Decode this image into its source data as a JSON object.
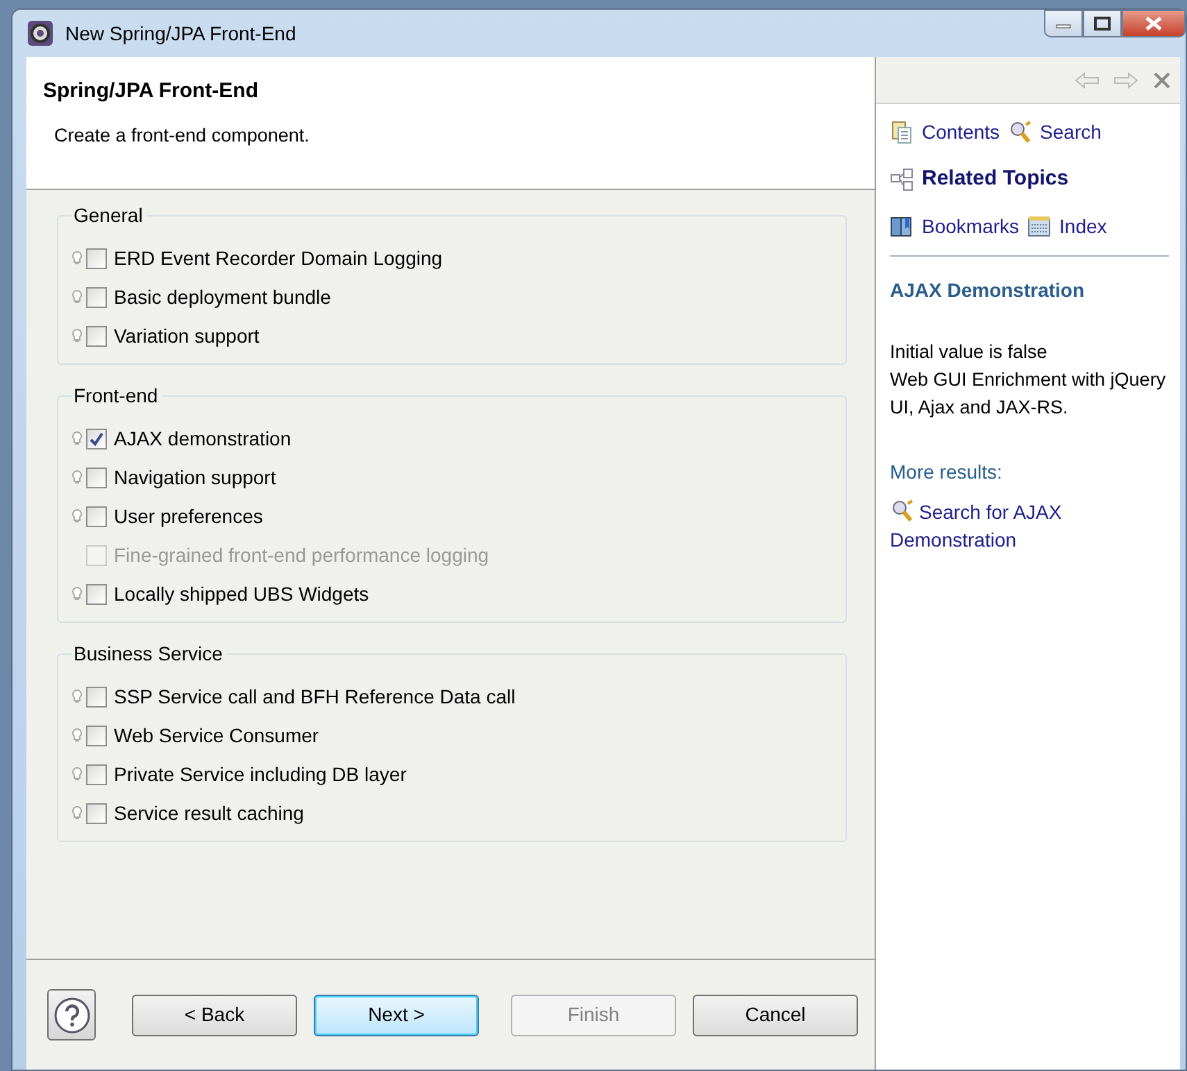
{
  "window": {
    "title": "New Spring/JPA Front-End"
  },
  "header": {
    "title": "Spring/JPA Front-End",
    "description": "Create a front-end component."
  },
  "groups": [
    {
      "title": "General",
      "items": [
        {
          "label": "ERD Event Recorder Domain Logging",
          "checked": false,
          "disabled": false,
          "hint_icon": true
        },
        {
          "label": "Basic deployment bundle",
          "checked": false,
          "disabled": false,
          "hint_icon": true
        },
        {
          "label": "Variation support",
          "checked": false,
          "disabled": false,
          "hint_icon": true
        }
      ]
    },
    {
      "title": "Front-end",
      "items": [
        {
          "label": "AJAX demonstration",
          "checked": true,
          "disabled": false,
          "hint_icon": true
        },
        {
          "label": "Navigation support",
          "checked": false,
          "disabled": false,
          "hint_icon": true
        },
        {
          "label": "User preferences",
          "checked": false,
          "disabled": false,
          "hint_icon": true
        },
        {
          "label": "Fine-grained front-end performance logging",
          "checked": false,
          "disabled": true,
          "hint_icon": false
        },
        {
          "label": "Locally shipped UBS Widgets",
          "checked": false,
          "disabled": false,
          "hint_icon": true
        }
      ]
    },
    {
      "title": "Business Service",
      "items": [
        {
          "label": "SSP Service call and BFH Reference Data call",
          "checked": false,
          "disabled": false,
          "hint_icon": true
        },
        {
          "label": "Web Service Consumer",
          "checked": false,
          "disabled": false,
          "hint_icon": true
        },
        {
          "label": "Private Service including DB layer",
          "checked": false,
          "disabled": false,
          "hint_icon": true
        },
        {
          "label": "Service result caching",
          "checked": false,
          "disabled": false,
          "hint_icon": true
        }
      ]
    }
  ],
  "buttons": [
    {
      "label": "< Back",
      "default": false,
      "disabled": false
    },
    {
      "label": "Next >",
      "default": true,
      "disabled": false
    },
    {
      "label": "Finish",
      "default": false,
      "disabled": true
    },
    {
      "label": "Cancel",
      "default": false,
      "disabled": false
    }
  ],
  "help": {
    "nav": [
      {
        "label": "Contents",
        "kind": "contents",
        "selected": false
      },
      {
        "label": "Search",
        "kind": "search",
        "selected": false
      },
      {
        "label": "Related Topics",
        "kind": "related",
        "selected": true
      },
      {
        "label": "Bookmarks",
        "kind": "bookmarks",
        "selected": false
      },
      {
        "label": "Index",
        "kind": "index",
        "selected": false
      }
    ],
    "topic_title": "AJAX Demonstration",
    "body_lines": [
      "Initial value is false",
      "Web GUI Enrichment with jQuery UI, Ajax and JAX-RS."
    ],
    "more_results_label": "More results:",
    "search_link": "Search for AJAX Demonstration"
  }
}
